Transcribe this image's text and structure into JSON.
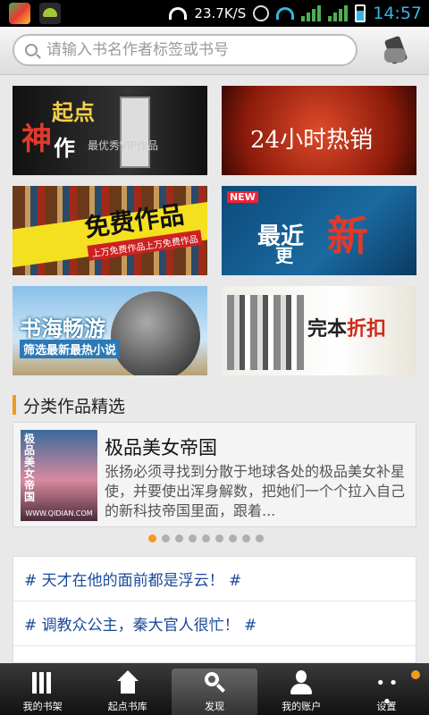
{
  "status_bar": {
    "speed": "23.7K/S",
    "network_3g": "3G",
    "sim_label": "G",
    "time": "14:57"
  },
  "search": {
    "placeholder": "请输入书名作者标签或书号"
  },
  "banners": {
    "b1": {
      "chars": [
        "神",
        "起点",
        "作"
      ],
      "subtitle": "最优秀VIP作品",
      "book_title": "神作"
    },
    "b2": {
      "text": "24小时热销"
    },
    "b3": {
      "text": "免费作品",
      "subtitle": "上万免费作品上万免费作品"
    },
    "b4": {
      "badge": "NEW",
      "text1": "最近",
      "text2": "更",
      "text3": "新"
    },
    "b5": {
      "text": "书海畅游",
      "subtitle": "筛选最新最热小说"
    },
    "b6": {
      "text_plain": "完本",
      "text_red": "折扣"
    }
  },
  "section": {
    "title": "分类作品精选"
  },
  "feature": {
    "cover_title": "极品美女帝国",
    "cover_site": "WWW.QIDIAN.COM",
    "title": "极品美女帝国",
    "description": "张扬必须寻找到分散于地球各处的极品美女补星使，并要使出浑身解数，把她们一个个拉入自己的新科技帝国里面，跟着..."
  },
  "pager": {
    "count": 9,
    "active": 1
  },
  "topics": [
    "# 天才在他的面前都是浮云！ #",
    "# 调教众公主，秦大官人很忙！ #"
  ],
  "tabs": {
    "shelf": "我的书架",
    "library": "起点书库",
    "discover": "发现",
    "account": "我的账户",
    "settings": "设置"
  },
  "colors": {
    "accent": "#f39a1e",
    "topic_link": "#1a4a9a",
    "status_time": "#33b5e5"
  },
  "icons": [
    "search-icon",
    "shake-icon",
    "bookshelf-icon",
    "home-icon",
    "discover-icon",
    "account-icon",
    "more-icon"
  ]
}
